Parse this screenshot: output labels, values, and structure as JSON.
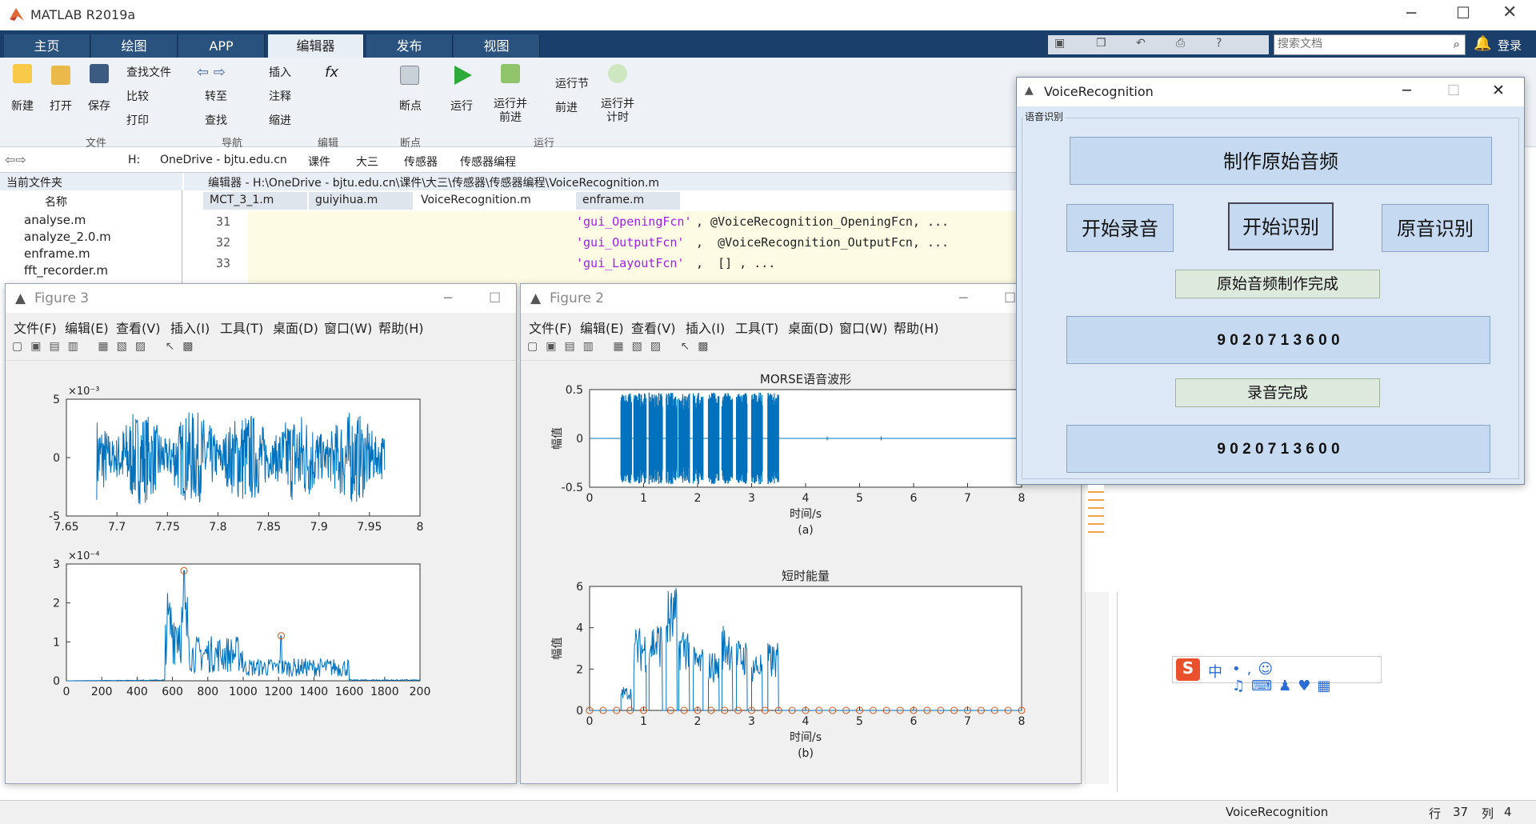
{
  "app": {
    "title": "MATLAB R2019a",
    "login": "登录",
    "search_placeholder": "搜索文档"
  },
  "tabs": [
    "主页",
    "绘图",
    "APP",
    "编辑器",
    "发布",
    "视图"
  ],
  "ribbon": {
    "file": {
      "new": "新建",
      "open": "打开",
      "save": "保存",
      "find_files": "查找文件",
      "compare": "比较",
      "print": "打印",
      "group": "文件"
    },
    "nav": {
      "goto": "转至",
      "find": "查找",
      "group": "导航"
    },
    "edit": {
      "insert": "插入",
      "comment": "注释",
      "indent": "缩进",
      "group": "编辑"
    },
    "breakpoints": {
      "label": "断点",
      "group": "断点"
    },
    "run": {
      "run": "运行",
      "run_advance": "运行并前进",
      "run_section": "运行节",
      "advance": "前进",
      "run_time": "运行并计时",
      "group": "运行"
    }
  },
  "address": {
    "drive": "H:",
    "crumbs": [
      "OneDrive - bjtu.edu.cn",
      "课件",
      "大三",
      "传感器",
      "传感器编程"
    ]
  },
  "filepanel": {
    "title": "当前文件夹",
    "col_name": "名称",
    "files": [
      "analyse.m",
      "analyze_2.0.m",
      "enframe.m",
      "fft_recorder.m"
    ]
  },
  "editor": {
    "title": "编辑器 - H:\\OneDrive - bjtu.edu.cn\\课件\\大三\\传感器\\传感器编程\\VoiceRecognition.m",
    "tabs": [
      "MCT_3_1.m",
      "guiyihua.m",
      "VoiceRecognition.m",
      "enframe.m"
    ],
    "lines": [
      {
        "n": "31",
        "s": "'gui_OpeningFcn'",
        "rest": ", @VoiceRecognition_OpeningFcn, ..."
      },
      {
        "n": "32",
        "s": "'gui_OutputFcn'",
        "rest": ",  @VoiceRecognition_OutputFcn, ..."
      },
      {
        "n": "33",
        "s": "'gui_LayoutFcn'",
        "rest": ",  [] , ..."
      }
    ]
  },
  "figure3": {
    "title": "Figure 3",
    "menu": [
      "文件(F)",
      "编辑(E)",
      "查看(V)",
      "插入(I)",
      "工具(T)",
      "桌面(D)",
      "窗口(W)",
      "帮助(H)"
    ]
  },
  "figure2": {
    "title": "Figure 2",
    "menu": [
      "文件(F)",
      "编辑(E)",
      "查看(V)",
      "插入(I)",
      "工具(T)",
      "桌面(D)",
      "窗口(W)",
      "帮助(H)"
    ]
  },
  "chart_data": [
    {
      "type": "line",
      "title": "",
      "xlim": [
        7.65,
        8.0
      ],
      "ylim": [
        -0.005,
        0.005
      ],
      "exponent": "×10⁻³",
      "xticks": [
        "7.65",
        "7.7",
        "7.75",
        "7.8",
        "7.85",
        "7.9",
        "7.95",
        "8"
      ],
      "yticks": [
        "5",
        "0",
        "-5"
      ],
      "series": [
        {
          "color": "#0072bd",
          "x": [
            7.68,
            7.965
          ],
          "amplitude": 0.004
        }
      ]
    },
    {
      "type": "line",
      "title": "",
      "xlim": [
        0,
        2000
      ],
      "ylim": [
        0,
        0.00035
      ],
      "exponent": "×10⁻⁴",
      "xticks": [
        "0",
        "200",
        "400",
        "600",
        "800",
        "1000",
        "1200",
        "1400",
        "1600",
        "1800",
        "200"
      ],
      "yticks": [
        "3",
        "2",
        "1",
        "0"
      ],
      "peaks": [
        {
          "x": 665,
          "y": 0.00033
        },
        {
          "x": 1215,
          "y": 0.000135
        }
      ],
      "peak_color": "#d95319",
      "series_color": "#0072bd"
    },
    {
      "type": "line",
      "title": "MORSE语音波形",
      "xlabel": "时间/s",
      "ylabel": "幅值",
      "caption": "(a)",
      "xlim": [
        0,
        8
      ],
      "ylim": [
        -0.5,
        0.5
      ],
      "xticks": [
        "0",
        "1",
        "2",
        "3",
        "4",
        "5",
        "6",
        "7",
        "8"
      ],
      "yticks": [
        "0.5",
        "0",
        "-0.5"
      ],
      "bursts": [
        [
          0.58,
          0.78
        ],
        [
          0.82,
          1.05
        ],
        [
          1.1,
          1.35
        ],
        [
          1.42,
          1.62
        ],
        [
          1.65,
          1.85
        ],
        [
          1.92,
          2.1
        ],
        [
          2.2,
          2.4
        ],
        [
          2.45,
          2.65
        ],
        [
          2.72,
          2.92
        ],
        [
          3.0,
          3.2
        ],
        [
          3.3,
          3.5
        ]
      ],
      "series_color": "#0072bd"
    },
    {
      "type": "line",
      "title": "短时能量",
      "xlabel": "时间/s",
      "ylabel": "幅值",
      "caption": "(b)",
      "xlim": [
        0,
        8
      ],
      "ylim": [
        0,
        6.2
      ],
      "xticks": [
        "0",
        "1",
        "2",
        "3",
        "4",
        "5",
        "6",
        "7",
        "8"
      ],
      "yticks": [
        "6",
        "4",
        "2",
        "0"
      ],
      "energy": [
        [
          0.58,
          0.78,
          1.2
        ],
        [
          0.82,
          1.05,
          4.2
        ],
        [
          1.1,
          1.35,
          4.6
        ],
        [
          1.42,
          1.62,
          6.2
        ],
        [
          1.65,
          1.85,
          4.4
        ],
        [
          1.92,
          2.1,
          3.2
        ],
        [
          2.2,
          2.4,
          3.0
        ],
        [
          2.45,
          2.65,
          4.4
        ],
        [
          2.72,
          2.92,
          3.6
        ],
        [
          3.0,
          3.2,
          3.0
        ],
        [
          3.3,
          3.5,
          3.4
        ]
      ],
      "markers_x": [
        0,
        0.25,
        0.5,
        0.75,
        1.0,
        1.5,
        1.75,
        2.0,
        2.25,
        2.5,
        2.75,
        3.0,
        3.25,
        3.5,
        3.75,
        4.0,
        4.25,
        4.5,
        4.75,
        5.0,
        5.25,
        5.5,
        5.75,
        6.0,
        6.25,
        6.5,
        6.75,
        7.0,
        7.25,
        7.5,
        7.75,
        8.0
      ],
      "series_color": "#0072bd",
      "marker_color": "#d95319"
    }
  ],
  "voice": {
    "title": "VoiceRecognition",
    "panel": "语音识别",
    "make_button": "制作原始音频",
    "record_button": "开始录音",
    "recognize_button": "开始识别",
    "original_button": "原音识别",
    "status1": "原始音频制作完成",
    "result1": "9 0 2 0 7 1 3 6 0 0",
    "status2": "录音完成",
    "result2": "9 0 2 0 7 1 3 6 0 0"
  },
  "status": {
    "script": "VoiceRecognition",
    "row_label": "行",
    "row": "37",
    "col_label": "列",
    "col": "4"
  },
  "ime": {
    "lang": "中"
  }
}
